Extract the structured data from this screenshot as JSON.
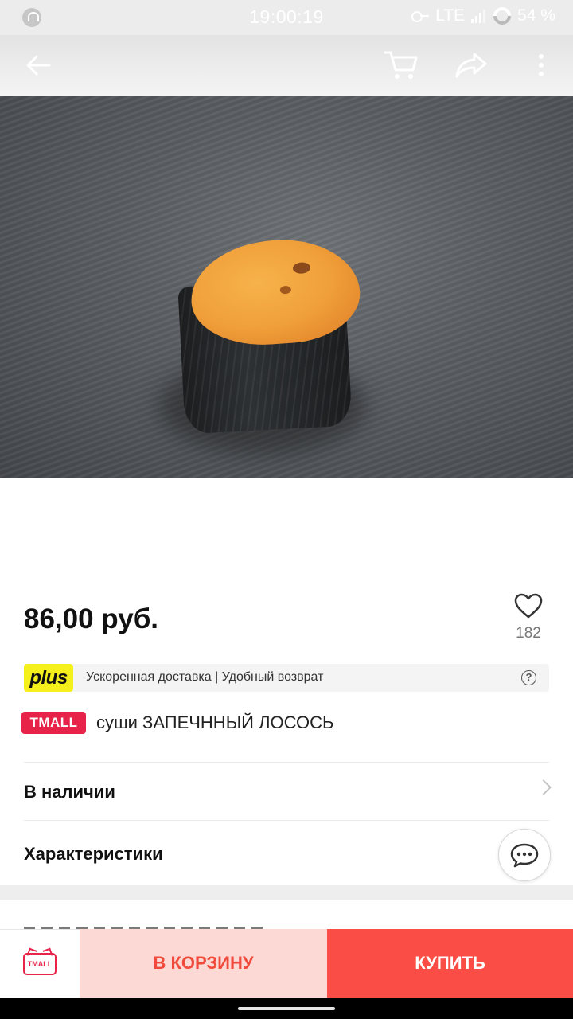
{
  "status_bar": {
    "time": "19:00:19",
    "network": "LTE",
    "battery": "54 %"
  },
  "app_bar": {
    "icons": [
      "back-arrow-icon",
      "cart-icon",
      "share-icon",
      "more-vertical-icon"
    ]
  },
  "product": {
    "price": "86,00 руб.",
    "favorites_count": "182",
    "plus_badge": "plus",
    "plus_text": "Ускоренная доставка | Удобный возврат",
    "store_badge": "TMALL",
    "title": "суши ЗАПЕЧННЫЙ ЛОСОСЬ"
  },
  "rows": {
    "availability": "В наличии",
    "specs": "Характеристики"
  },
  "actions": {
    "store_logo": "TMALL",
    "add_to_cart": "В КОРЗИНУ",
    "buy": "КУПИТЬ"
  },
  "colors": {
    "accent_red": "#fa4d46",
    "cart_pink": "#fdd9d6",
    "tmall_red": "#e8234a",
    "plus_yellow": "#f5f01c"
  }
}
